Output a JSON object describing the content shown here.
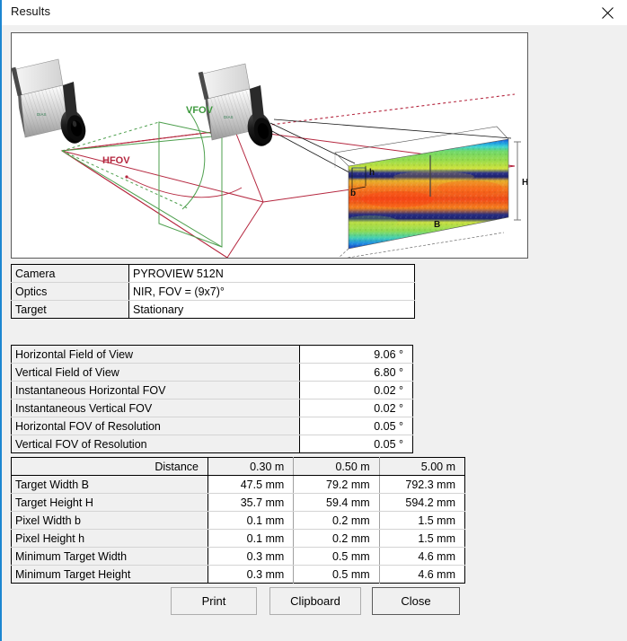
{
  "window": {
    "title": "Results",
    "close_icon": "close-x-icon",
    "accent_color": "#1c86d1"
  },
  "diagram": {
    "labels": {
      "vfov": "VFOV",
      "hfov": "HFOV",
      "target_width": "B",
      "target_height": "H",
      "pixel_width": "b",
      "pixel_height": "h"
    },
    "colors": {
      "vfov": "#3f9a3f",
      "hfov": "#b5273f",
      "camera_body": "#c8c8c8",
      "camera_lens": "#1a1a1a"
    }
  },
  "camera_table": {
    "rows": [
      {
        "label": "Camera",
        "value": "PYROVIEW 512N"
      },
      {
        "label": "Optics",
        "value": "NIR, FOV = (9x7)°"
      },
      {
        "label": "Target",
        "value": "Stationary"
      }
    ]
  },
  "fov_table": {
    "rows": [
      {
        "label": "Horizontal Field of View",
        "value": "9.06 °"
      },
      {
        "label": "Vertical Field of View",
        "value": "6.80 °"
      },
      {
        "label": "Instantaneous Horizontal FOV",
        "value": "0.02 °"
      },
      {
        "label": "Instantaneous Vertical FOV",
        "value": "0.02 °"
      },
      {
        "label": "Horizontal FOV of Resolution",
        "value": "0.05 °"
      },
      {
        "label": "Vertical FOV of Resolution",
        "value": "0.05 °"
      }
    ]
  },
  "distance_table": {
    "header": [
      "Distance",
      "0.30 m",
      "0.50 m",
      "5.00 m"
    ],
    "rows": [
      {
        "label": "Target Width B",
        "values": [
          "47.5 mm",
          "79.2 mm",
          "792.3 mm"
        ]
      },
      {
        "label": "Target Height H",
        "values": [
          "35.7 mm",
          "59.4 mm",
          "594.2 mm"
        ]
      },
      {
        "label": "Pixel Width b",
        "values": [
          "0.1 mm",
          "0.2 mm",
          "1.5 mm"
        ]
      },
      {
        "label": "Pixel Height h",
        "values": [
          "0.1 mm",
          "0.2 mm",
          "1.5 mm"
        ]
      },
      {
        "label": "Minimum Target Width",
        "values": [
          "0.3 mm",
          "0.5 mm",
          "4.6 mm"
        ]
      },
      {
        "label": "Minimum Target Height",
        "values": [
          "0.3 mm",
          "0.5 mm",
          "4.6 mm"
        ]
      }
    ]
  },
  "buttons": {
    "print": "Print",
    "clipboard": "Clipboard",
    "close": "Close"
  }
}
